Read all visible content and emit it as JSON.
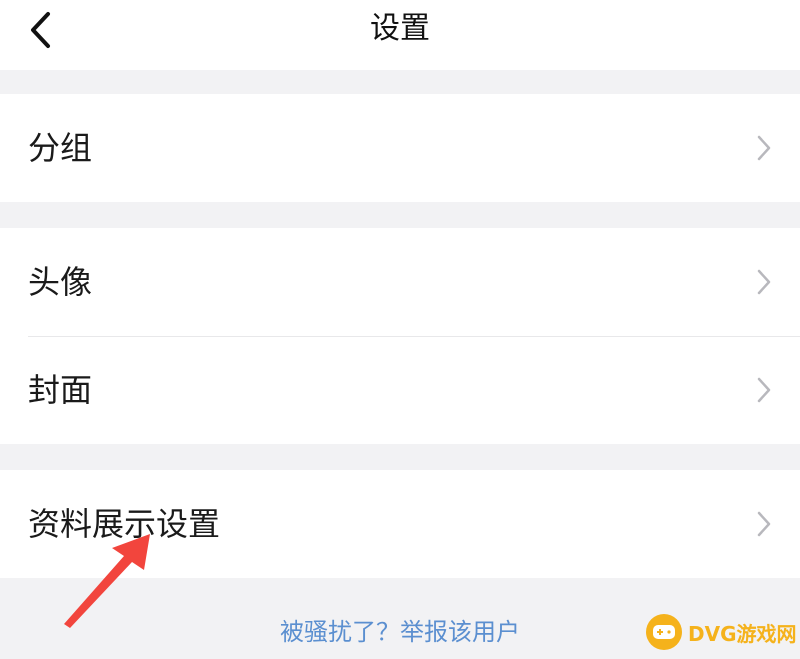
{
  "header": {
    "title": "设置"
  },
  "groups": [
    {
      "items": [
        {
          "label": "分组"
        }
      ]
    },
    {
      "items": [
        {
          "label": "头像"
        },
        {
          "label": "封面"
        }
      ]
    },
    {
      "items": [
        {
          "label": "资料展示设置"
        }
      ]
    }
  ],
  "footer": {
    "report_text": "被骚扰了？举报该用户"
  },
  "watermark": {
    "text": "DVG游戏网"
  },
  "colors": {
    "background": "#f2f2f4",
    "card": "#ffffff",
    "link": "#5b8fd0",
    "arrow": "#f2453d",
    "watermark": "#f5b21b"
  }
}
